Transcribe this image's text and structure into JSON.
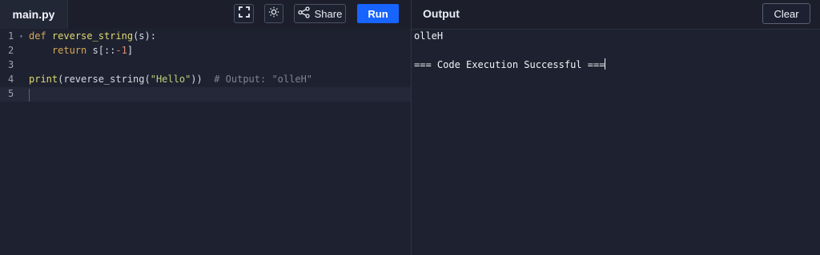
{
  "file_tab": {
    "label": "main.py"
  },
  "toolbar": {
    "fullscreen_icon": "fullscreen-icon",
    "theme_icon": "sun-icon",
    "share_icon": "share-icon",
    "share_label": "Share",
    "run_label": "Run",
    "accent": "#1764ff"
  },
  "output_panel": {
    "title": "Output",
    "clear_label": "Clear",
    "lines": [
      "olleH",
      "",
      "=== Code Execution Successful ==="
    ]
  },
  "editor": {
    "line_numbers": [
      "1",
      "2",
      "3",
      "4",
      "5"
    ],
    "code": {
      "line1": {
        "kw": "def",
        "fn": "reverse_string",
        "rest": "(s):"
      },
      "line2": {
        "kw": "return",
        "before": "s[::",
        "num": "-1",
        "after": "]"
      },
      "line4": {
        "fn": "print",
        "open": "(reverse_string(",
        "str": "\"Hello\"",
        "close": "))",
        "comment": "# Output: \"olleH\""
      }
    }
  }
}
